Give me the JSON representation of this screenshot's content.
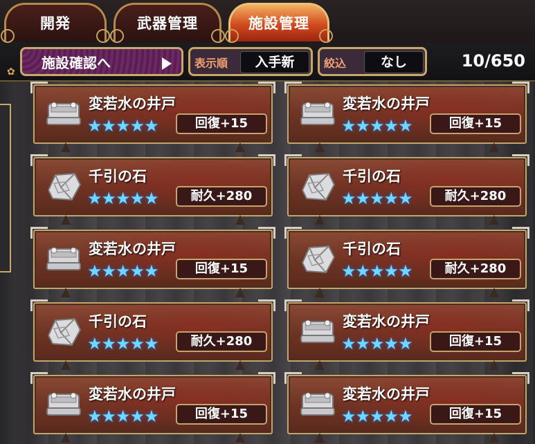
{
  "tabs": [
    {
      "label": "開発",
      "active": false
    },
    {
      "label": "武器管理",
      "active": false
    },
    {
      "label": "施設管理",
      "active": true
    }
  ],
  "toolbar": {
    "confirm_label": "施設確認へ",
    "sort_key": "表示順",
    "sort_value": "入手新",
    "filter_key": "絞込",
    "filter_value": "なし",
    "count": "10/650"
  },
  "cards": [
    {
      "name": "変若水の井戸",
      "stars": "★★★★★",
      "rarity": 5,
      "stat": "回復+15",
      "icon": "well-icon"
    },
    {
      "name": "変若水の井戸",
      "stars": "★★★★★",
      "rarity": 5,
      "stat": "回復+15",
      "icon": "well-icon"
    },
    {
      "name": "千引の石",
      "stars": "★★★★★",
      "rarity": 5,
      "stat": "耐久+280",
      "icon": "stone-icon"
    },
    {
      "name": "千引の石",
      "stars": "★★★★★",
      "rarity": 5,
      "stat": "耐久+280",
      "icon": "stone-icon"
    },
    {
      "name": "変若水の井戸",
      "stars": "★★★★★",
      "rarity": 5,
      "stat": "回復+15",
      "icon": "well-icon"
    },
    {
      "name": "千引の石",
      "stars": "★★★★★",
      "rarity": 5,
      "stat": "耐久+280",
      "icon": "stone-icon"
    },
    {
      "name": "千引の石",
      "stars": "★★★★★",
      "rarity": 5,
      "stat": "耐久+280",
      "icon": "stone-icon"
    },
    {
      "name": "変若水の井戸",
      "stars": "★★★★★",
      "rarity": 5,
      "stat": "回復+15",
      "icon": "well-icon"
    },
    {
      "name": "変若水の井戸",
      "stars": "★★★★★",
      "rarity": 5,
      "stat": "回復+15",
      "icon": "well-icon"
    },
    {
      "name": "変若水の井戸",
      "stars": "★★★★★",
      "rarity": 5,
      "stat": "回復+15",
      "icon": "well-icon"
    }
  ],
  "colors": {
    "active_tab": "#d14a1e",
    "star": "#6fd8ff",
    "card": "#6e3424",
    "gold_border": "#c7a36e"
  }
}
